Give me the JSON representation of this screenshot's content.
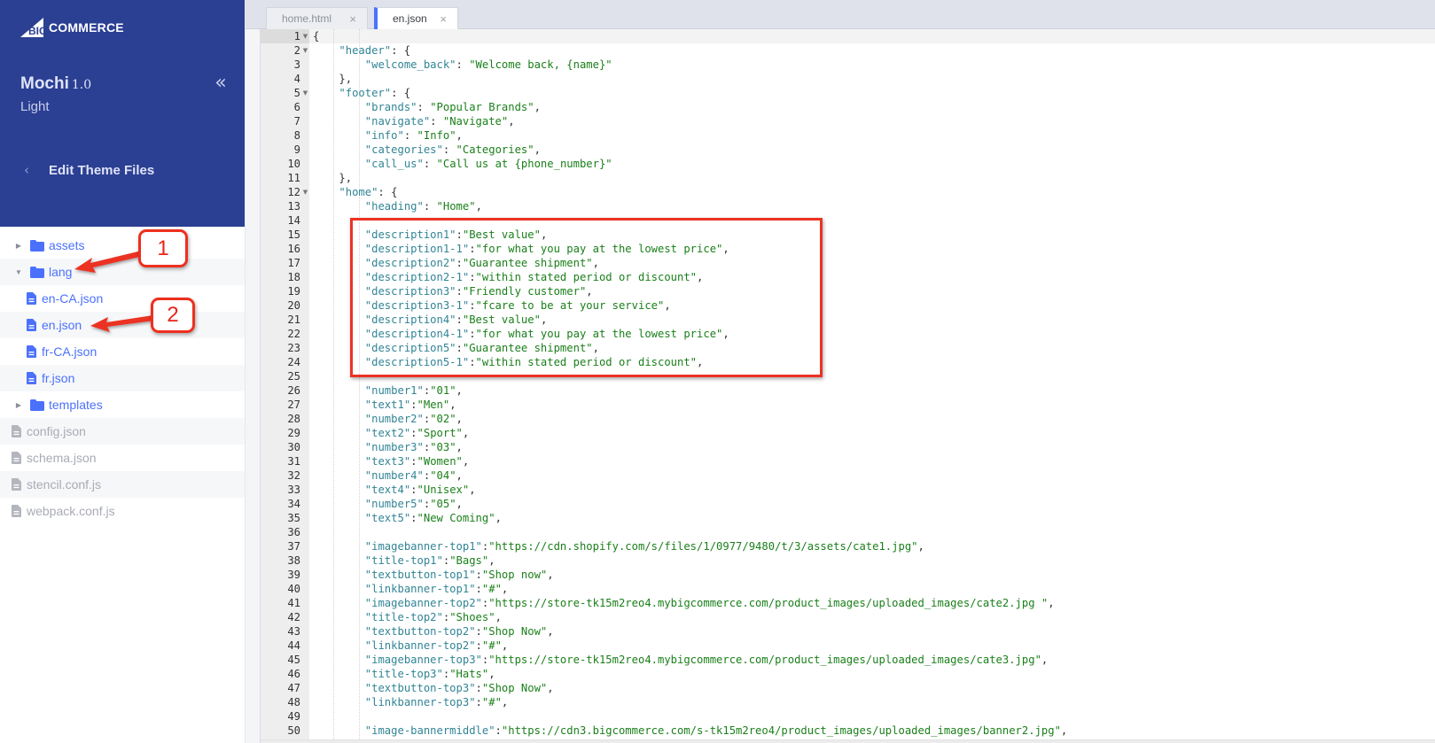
{
  "brand": {
    "name": "BIGCOMMERCE",
    "prefix": "BIG",
    "suffix": "COMMERCE"
  },
  "theme": {
    "name": "Mochi",
    "version": "1.0",
    "variant": "Light",
    "collapse_icon": "«"
  },
  "nav": {
    "back_label": "Edit Theme Files",
    "back_icon": "‹"
  },
  "file_tree": [
    {
      "type": "folder",
      "name": "assets",
      "expanded": false,
      "level": 0
    },
    {
      "type": "folder",
      "name": "lang",
      "expanded": true,
      "level": 0
    },
    {
      "type": "file",
      "name": "en-CA.json",
      "level": 1
    },
    {
      "type": "file",
      "name": "en.json",
      "level": 1
    },
    {
      "type": "file",
      "name": "fr-CA.json",
      "level": 1
    },
    {
      "type": "file",
      "name": "fr.json",
      "level": 1
    },
    {
      "type": "folder",
      "name": "templates",
      "expanded": false,
      "level": 0
    },
    {
      "type": "readonly-file",
      "name": "config.json",
      "level": 0
    },
    {
      "type": "readonly-file",
      "name": "schema.json",
      "level": 0
    },
    {
      "type": "readonly-file",
      "name": "stencil.conf.js",
      "level": 0
    },
    {
      "type": "readonly-file",
      "name": "webpack.conf.js",
      "level": 0
    }
  ],
  "tabs": [
    {
      "label": "home.html",
      "close": "×",
      "active": false
    },
    {
      "label": "en.json",
      "close": "×",
      "active": true
    }
  ],
  "editor": {
    "active_line": 1,
    "lines": [
      {
        "n": 1,
        "fold": true,
        "indent": 0,
        "tokens": [
          [
            "p",
            "{"
          ]
        ]
      },
      {
        "n": 2,
        "fold": true,
        "indent": 1,
        "tokens": [
          [
            "k",
            "\"header\""
          ],
          [
            "p",
            ": {"
          ]
        ]
      },
      {
        "n": 3,
        "indent": 2,
        "tokens": [
          [
            "k",
            "\"welcome_back\""
          ],
          [
            "p",
            ": "
          ],
          [
            "s",
            "\"Welcome back, {name}\""
          ]
        ]
      },
      {
        "n": 4,
        "indent": 1,
        "tokens": [
          [
            "p",
            "},"
          ]
        ]
      },
      {
        "n": 5,
        "fold": true,
        "indent": 1,
        "tokens": [
          [
            "k",
            "\"footer\""
          ],
          [
            "p",
            ": {"
          ]
        ]
      },
      {
        "n": 6,
        "indent": 2,
        "tokens": [
          [
            "k",
            "\"brands\""
          ],
          [
            "p",
            ": "
          ],
          [
            "s",
            "\"Popular Brands\""
          ],
          [
            "p",
            ","
          ]
        ]
      },
      {
        "n": 7,
        "indent": 2,
        "tokens": [
          [
            "k",
            "\"navigate\""
          ],
          [
            "p",
            ": "
          ],
          [
            "s",
            "\"Navigate\""
          ],
          [
            "p",
            ","
          ]
        ]
      },
      {
        "n": 8,
        "indent": 2,
        "tokens": [
          [
            "k",
            "\"info\""
          ],
          [
            "p",
            ": "
          ],
          [
            "s",
            "\"Info\""
          ],
          [
            "p",
            ","
          ]
        ]
      },
      {
        "n": 9,
        "indent": 2,
        "tokens": [
          [
            "k",
            "\"categories\""
          ],
          [
            "p",
            ": "
          ],
          [
            "s",
            "\"Categories\""
          ],
          [
            "p",
            ","
          ]
        ]
      },
      {
        "n": 10,
        "indent": 2,
        "tokens": [
          [
            "k",
            "\"call_us\""
          ],
          [
            "p",
            ": "
          ],
          [
            "s",
            "\"Call us at {phone_number}\""
          ]
        ]
      },
      {
        "n": 11,
        "indent": 1,
        "tokens": [
          [
            "p",
            "},"
          ]
        ]
      },
      {
        "n": 12,
        "fold": true,
        "indent": 1,
        "tokens": [
          [
            "k",
            "\"home\""
          ],
          [
            "p",
            ": {"
          ]
        ]
      },
      {
        "n": 13,
        "indent": 2,
        "tokens": [
          [
            "k",
            "\"heading\""
          ],
          [
            "p",
            ": "
          ],
          [
            "s",
            "\"Home\""
          ],
          [
            "p",
            ","
          ]
        ]
      },
      {
        "n": 14,
        "indent": 0,
        "tokens": []
      },
      {
        "n": 15,
        "indent": 2,
        "tokens": [
          [
            "k",
            "\"description1\""
          ],
          [
            "p",
            ":"
          ],
          [
            "s",
            "\"Best value\""
          ],
          [
            "p",
            ","
          ]
        ]
      },
      {
        "n": 16,
        "indent": 2,
        "tokens": [
          [
            "k",
            "\"description1-1\""
          ],
          [
            "p",
            ":"
          ],
          [
            "s",
            "\"for what you pay at the lowest price\""
          ],
          [
            "p",
            ","
          ]
        ]
      },
      {
        "n": 17,
        "indent": 2,
        "tokens": [
          [
            "k",
            "\"description2\""
          ],
          [
            "p",
            ":"
          ],
          [
            "s",
            "\"Guarantee shipment\""
          ],
          [
            "p",
            ","
          ]
        ]
      },
      {
        "n": 18,
        "indent": 2,
        "tokens": [
          [
            "k",
            "\"description2-1\""
          ],
          [
            "p",
            ":"
          ],
          [
            "s",
            "\"within stated period or discount\""
          ],
          [
            "p",
            ","
          ]
        ]
      },
      {
        "n": 19,
        "indent": 2,
        "tokens": [
          [
            "k",
            "\"description3\""
          ],
          [
            "p",
            ":"
          ],
          [
            "s",
            "\"Friendly customer\""
          ],
          [
            "p",
            ","
          ]
        ]
      },
      {
        "n": 20,
        "indent": 2,
        "tokens": [
          [
            "k",
            "\"description3-1\""
          ],
          [
            "p",
            ":"
          ],
          [
            "s",
            "\"fcare to be at your service\""
          ],
          [
            "p",
            ","
          ]
        ]
      },
      {
        "n": 21,
        "indent": 2,
        "tokens": [
          [
            "k",
            "\"description4\""
          ],
          [
            "p",
            ":"
          ],
          [
            "s",
            "\"Best value\""
          ],
          [
            "p",
            ","
          ]
        ]
      },
      {
        "n": 22,
        "indent": 2,
        "tokens": [
          [
            "k",
            "\"description4-1\""
          ],
          [
            "p",
            ":"
          ],
          [
            "s",
            "\"for what you pay at the lowest price\""
          ],
          [
            "p",
            ","
          ]
        ]
      },
      {
        "n": 23,
        "indent": 2,
        "tokens": [
          [
            "k",
            "\"description5\""
          ],
          [
            "p",
            ":"
          ],
          [
            "s",
            "\"Guarantee shipment\""
          ],
          [
            "p",
            ","
          ]
        ]
      },
      {
        "n": 24,
        "indent": 2,
        "tokens": [
          [
            "k",
            "\"description5-1\""
          ],
          [
            "p",
            ":"
          ],
          [
            "s",
            "\"within stated period or discount\""
          ],
          [
            "p",
            ","
          ]
        ]
      },
      {
        "n": 25,
        "indent": 0,
        "tokens": []
      },
      {
        "n": 26,
        "indent": 2,
        "tokens": [
          [
            "k",
            "\"number1\""
          ],
          [
            "p",
            ":"
          ],
          [
            "s",
            "\"01\""
          ],
          [
            "p",
            ","
          ]
        ]
      },
      {
        "n": 27,
        "indent": 2,
        "tokens": [
          [
            "k",
            "\"text1\""
          ],
          [
            "p",
            ":"
          ],
          [
            "s",
            "\"Men\""
          ],
          [
            "p",
            ","
          ]
        ]
      },
      {
        "n": 28,
        "indent": 2,
        "tokens": [
          [
            "k",
            "\"number2\""
          ],
          [
            "p",
            ":"
          ],
          [
            "s",
            "\"02\""
          ],
          [
            "p",
            ","
          ]
        ]
      },
      {
        "n": 29,
        "indent": 2,
        "tokens": [
          [
            "k",
            "\"text2\""
          ],
          [
            "p",
            ":"
          ],
          [
            "s",
            "\"Sport\""
          ],
          [
            "p",
            ","
          ]
        ]
      },
      {
        "n": 30,
        "indent": 2,
        "tokens": [
          [
            "k",
            "\"number3\""
          ],
          [
            "p",
            ":"
          ],
          [
            "s",
            "\"03\""
          ],
          [
            "p",
            ","
          ]
        ]
      },
      {
        "n": 31,
        "indent": 2,
        "tokens": [
          [
            "k",
            "\"text3\""
          ],
          [
            "p",
            ":"
          ],
          [
            "s",
            "\"Women\""
          ],
          [
            "p",
            ","
          ]
        ]
      },
      {
        "n": 32,
        "indent": 2,
        "tokens": [
          [
            "k",
            "\"number4\""
          ],
          [
            "p",
            ":"
          ],
          [
            "s",
            "\"04\""
          ],
          [
            "p",
            ","
          ]
        ]
      },
      {
        "n": 33,
        "indent": 2,
        "tokens": [
          [
            "k",
            "\"text4\""
          ],
          [
            "p",
            ":"
          ],
          [
            "s",
            "\"Unisex\""
          ],
          [
            "p",
            ","
          ]
        ]
      },
      {
        "n": 34,
        "indent": 2,
        "tokens": [
          [
            "k",
            "\"number5\""
          ],
          [
            "p",
            ":"
          ],
          [
            "s",
            "\"05\""
          ],
          [
            "p",
            ","
          ]
        ]
      },
      {
        "n": 35,
        "indent": 2,
        "tokens": [
          [
            "k",
            "\"text5\""
          ],
          [
            "p",
            ":"
          ],
          [
            "s",
            "\"New Coming\""
          ],
          [
            "p",
            ","
          ]
        ]
      },
      {
        "n": 36,
        "indent": 0,
        "tokens": []
      },
      {
        "n": 37,
        "indent": 2,
        "tokens": [
          [
            "k",
            "\"imagebanner-top1\""
          ],
          [
            "p",
            ":"
          ],
          [
            "s",
            "\"https://cdn.shopify.com/s/files/1/0977/9480/t/3/assets/cate1.jpg\""
          ],
          [
            "p",
            ","
          ]
        ]
      },
      {
        "n": 38,
        "indent": 2,
        "tokens": [
          [
            "k",
            "\"title-top1\""
          ],
          [
            "p",
            ":"
          ],
          [
            "s",
            "\"Bags\""
          ],
          [
            "p",
            ","
          ]
        ]
      },
      {
        "n": 39,
        "indent": 2,
        "tokens": [
          [
            "k",
            "\"textbutton-top1\""
          ],
          [
            "p",
            ":"
          ],
          [
            "s",
            "\"Shop now\""
          ],
          [
            "p",
            ","
          ]
        ]
      },
      {
        "n": 40,
        "indent": 2,
        "tokens": [
          [
            "k",
            "\"linkbanner-top1\""
          ],
          [
            "p",
            ":"
          ],
          [
            "s",
            "\"#\""
          ],
          [
            "p",
            ","
          ]
        ]
      },
      {
        "n": 41,
        "indent": 2,
        "tokens": [
          [
            "k",
            "\"imagebanner-top2\""
          ],
          [
            "p",
            ":"
          ],
          [
            "s",
            "\"https://store-tk15m2reo4.mybigcommerce.com/product_images/uploaded_images/cate2.jpg \""
          ],
          [
            "p",
            ","
          ]
        ]
      },
      {
        "n": 42,
        "indent": 2,
        "tokens": [
          [
            "k",
            "\"title-top2\""
          ],
          [
            "p",
            ":"
          ],
          [
            "s",
            "\"Shoes\""
          ],
          [
            "p",
            ","
          ]
        ]
      },
      {
        "n": 43,
        "indent": 2,
        "tokens": [
          [
            "k",
            "\"textbutton-top2\""
          ],
          [
            "p",
            ":"
          ],
          [
            "s",
            "\"Shop Now\""
          ],
          [
            "p",
            ","
          ]
        ]
      },
      {
        "n": 44,
        "indent": 2,
        "tokens": [
          [
            "k",
            "\"linkbanner-top2\""
          ],
          [
            "p",
            ":"
          ],
          [
            "s",
            "\"#\""
          ],
          [
            "p",
            ","
          ]
        ]
      },
      {
        "n": 45,
        "indent": 2,
        "tokens": [
          [
            "k",
            "\"imagebanner-top3\""
          ],
          [
            "p",
            ":"
          ],
          [
            "s",
            "\"https://store-tk15m2reo4.mybigcommerce.com/product_images/uploaded_images/cate3.jpg\""
          ],
          [
            "p",
            ","
          ]
        ]
      },
      {
        "n": 46,
        "indent": 2,
        "tokens": [
          [
            "k",
            "\"title-top3\""
          ],
          [
            "p",
            ":"
          ],
          [
            "s",
            "\"Hats\""
          ],
          [
            "p",
            ","
          ]
        ]
      },
      {
        "n": 47,
        "indent": 2,
        "tokens": [
          [
            "k",
            "\"textbutton-top3\""
          ],
          [
            "p",
            ":"
          ],
          [
            "s",
            "\"Shop Now\""
          ],
          [
            "p",
            ","
          ]
        ]
      },
      {
        "n": 48,
        "indent": 2,
        "tokens": [
          [
            "k",
            "\"linkbanner-top3\""
          ],
          [
            "p",
            ":"
          ],
          [
            "s",
            "\"#\""
          ],
          [
            "p",
            ","
          ]
        ]
      },
      {
        "n": 49,
        "indent": 0,
        "tokens": []
      },
      {
        "n": 50,
        "indent": 2,
        "tokens": [
          [
            "k",
            "\"image-bannermiddle\""
          ],
          [
            "p",
            ":"
          ],
          [
            "s",
            "\"https://cdn3.bigcommerce.com/s-tk15m2reo4/product_images/uploaded_images/banner2.jpg\""
          ],
          [
            "p",
            ","
          ]
        ]
      }
    ]
  },
  "annotations": [
    {
      "label": "1",
      "target": "lang"
    },
    {
      "label": "2",
      "target": "en.json"
    }
  ],
  "colors": {
    "sidebar_header": "#2b3f93",
    "link_blue": "#4b71fc",
    "json_key": "#318495",
    "json_string": "#1a7f1a",
    "annotation_red": "#ec3324"
  }
}
